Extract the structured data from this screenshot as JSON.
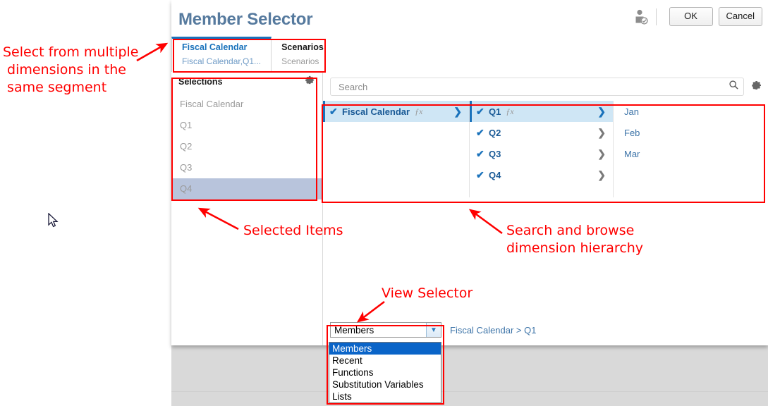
{
  "dialog": {
    "title": "Member Selector",
    "header_icon": "person-with-badge-icon",
    "ok_label": "OK",
    "cancel_label": "Cancel"
  },
  "tabs": [
    {
      "title": "Fiscal Calendar",
      "subtitle": "Fiscal Calendar,Q1...",
      "active": true
    },
    {
      "title": "Scenarios",
      "subtitle": "Scenarios",
      "active": false
    }
  ],
  "selections": {
    "header": "Selections",
    "gear_icon": "gear-icon",
    "items": [
      {
        "label": "Fiscal Calendar",
        "selected": false
      },
      {
        "label": "Q1",
        "selected": false
      },
      {
        "label": "Q2",
        "selected": false
      },
      {
        "label": "Q3",
        "selected": false
      },
      {
        "label": "Q4",
        "selected": true
      }
    ]
  },
  "search": {
    "value": "",
    "placeholder": "Search",
    "search_icon": "search-icon",
    "gear_icon": "gear-icon"
  },
  "browse": {
    "column1": [
      {
        "label": "Fiscal Calendar",
        "checked": true,
        "fx": "ƒx",
        "has_children": true,
        "selected": true
      }
    ],
    "column2": [
      {
        "label": "Q1",
        "checked": true,
        "fx": "ƒx",
        "has_children": true,
        "selected": true
      },
      {
        "label": "Q2",
        "checked": true,
        "fx": "",
        "has_children": true,
        "selected": false
      },
      {
        "label": "Q3",
        "checked": true,
        "fx": "",
        "has_children": true,
        "selected": false
      },
      {
        "label": "Q4",
        "checked": true,
        "fx": "",
        "has_children": true,
        "selected": false
      }
    ],
    "column3": [
      {
        "label": "Jan"
      },
      {
        "label": "Feb"
      },
      {
        "label": "Mar"
      }
    ],
    "check_glyph": "✔",
    "chevron_glyph": "❯"
  },
  "view_selector": {
    "selected": "Members",
    "arrow_icon": "chevron-down-icon",
    "options": [
      {
        "label": "Members",
        "highlighted": true
      },
      {
        "label": "Recent",
        "highlighted": false
      },
      {
        "label": "Functions",
        "highlighted": false
      },
      {
        "label": "Substitution Variables",
        "highlighted": false
      },
      {
        "label": "Lists",
        "highlighted": false
      }
    ]
  },
  "breadcrumb": "Fiscal Calendar > Q1",
  "annotations": {
    "multi_dimension": "Select from multiple\n dimensions in the\n same segment",
    "selected_items": "Selected Items",
    "search_browse": "Search and browse\ndimension hierarchy",
    "view_selector": "View Selector",
    "color": "#ff0000"
  }
}
